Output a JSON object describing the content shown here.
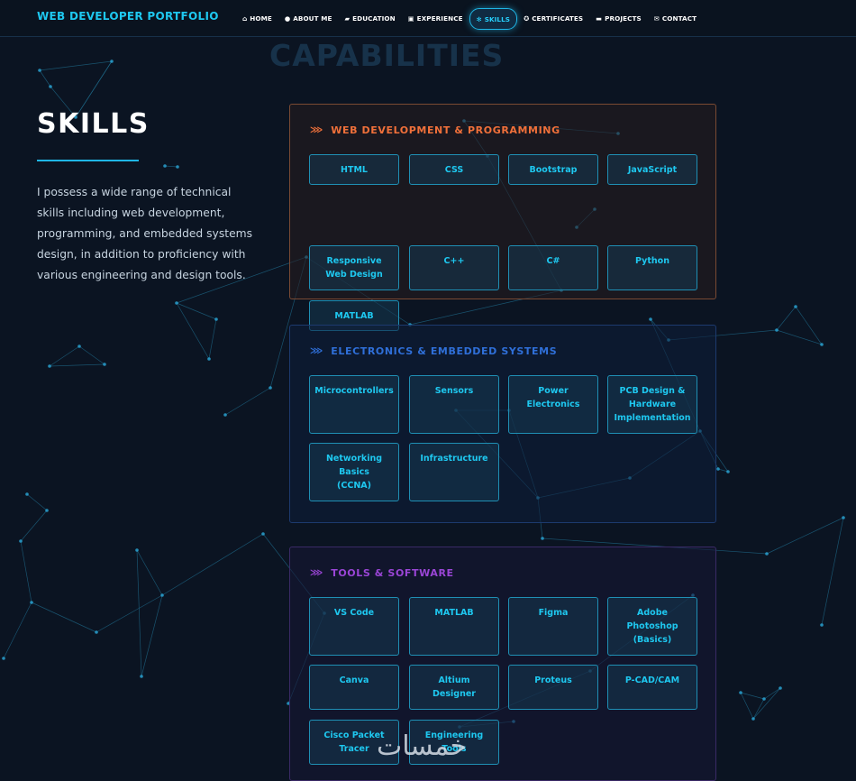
{
  "brand": "WEB DEVELOPER PORTFOLIO",
  "nav": [
    {
      "label": "HOME",
      "icon": "home-icon",
      "glyph": "⌂"
    },
    {
      "label": "ABOUT ME",
      "icon": "user-icon",
      "glyph": "●"
    },
    {
      "label": "EDUCATION",
      "icon": "graduation-cap-icon",
      "glyph": "▰"
    },
    {
      "label": "EXPERIENCE",
      "icon": "briefcase-icon",
      "glyph": "▣"
    },
    {
      "label": "SKILLS",
      "icon": "gear-icon",
      "glyph": "✻",
      "active": true
    },
    {
      "label": "CERTIFICATES",
      "icon": "award-icon",
      "glyph": "✪"
    },
    {
      "label": "PROJECTS",
      "icon": "folder-icon",
      "glyph": "▬"
    },
    {
      "label": "CONTACT",
      "icon": "envelope-icon",
      "glyph": "✉"
    }
  ],
  "ghost_title": "CAPABILITIES",
  "section_title": "SKILLS",
  "intro": "I possess a wide range of technical skills including web development, programming, and embedded systems design, in addition to proficiency with various engineering and design tools.",
  "panels": [
    {
      "title": "WEB DEVELOPMENT & PROGRAMMING",
      "accent": "#f0703a",
      "border": "#7a4a33",
      "bg": "rgba(40,28,30,0.55)",
      "chips": [
        [
          "HTML"
        ],
        [
          "CSS"
        ],
        [
          "Bootstrap"
        ],
        [
          "JavaScript"
        ],
        [
          "Responsive",
          "Web Design"
        ],
        [
          "C++"
        ],
        [
          "C#"
        ],
        [
          "Python"
        ],
        [
          "MATLAB"
        ]
      ]
    },
    {
      "title": "ELECTRONICS & EMBEDDED SYSTEMS",
      "accent": "#2f6fd8",
      "border": "#1d3a6e",
      "bg": "rgba(14,30,58,0.55)",
      "chips": [
        [
          "Microcontrollers"
        ],
        [
          "Sensors"
        ],
        [
          "Power",
          "Electronics"
        ],
        [
          "PCB Design &",
          "Hardware",
          "Implementation"
        ],
        [
          "Networking",
          "Basics",
          "(CCNA)"
        ],
        [
          "Infrastructure"
        ]
      ]
    },
    {
      "title": "TOOLS & SOFTWARE",
      "accent": "#9a45d6",
      "border": "#3a2a66",
      "bg": "rgba(24,22,52,0.55)",
      "chips": [
        [
          "VS Code"
        ],
        [
          "MATLAB"
        ],
        [
          "Figma"
        ],
        [
          "Adobe",
          "Photoshop",
          "(Basics)"
        ],
        [
          "Canva"
        ],
        [
          "Altium",
          "Designer"
        ],
        [
          "Proteus"
        ],
        [
          "P-CAD/CAM"
        ],
        [
          "Cisco Packet",
          "Tracer"
        ],
        [
          "Engineering",
          "Tools"
        ]
      ]
    }
  ],
  "watermark": "خمسات"
}
